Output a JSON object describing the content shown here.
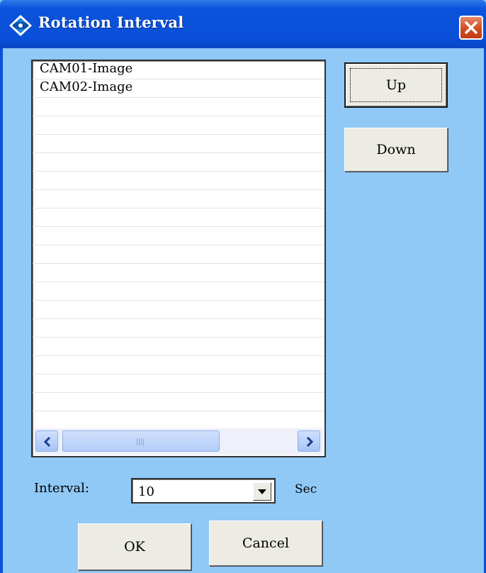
{
  "window": {
    "title": "Rotation Interval",
    "title_icon": "diamond-eye-icon",
    "close_icon": "close-icon"
  },
  "cameras": {
    "items": [
      "CAM01-Image",
      "CAM02-Image"
    ]
  },
  "scrollbar": {
    "left_icon": "scroll-left-icon",
    "right_icon": "scroll-right-icon"
  },
  "buttons": {
    "up": "Up",
    "down": "Down",
    "ok": "OK",
    "cancel": "Cancel"
  },
  "interval": {
    "label": "Interval:",
    "value": "10",
    "unit": "Sec"
  },
  "colors": {
    "titlebar": "#0a4fd8",
    "client": "#90c8f6",
    "close": "#d24b22"
  }
}
